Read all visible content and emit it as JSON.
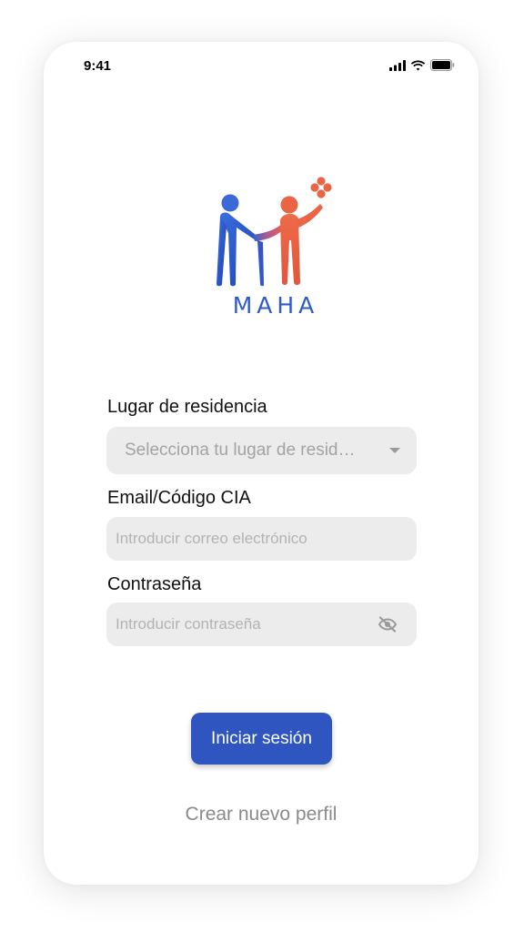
{
  "status_bar": {
    "time": "9:41",
    "icons": [
      "signal-icon",
      "wifi-icon",
      "battery-icon"
    ]
  },
  "logo": {
    "text": "MAHA",
    "colors": {
      "blue": "#2f5bc6",
      "orange": "#ea6446"
    }
  },
  "form": {
    "residence": {
      "label": "Lugar de residencia",
      "value": "Selecciona tu lugar de resid…"
    },
    "email": {
      "label": "Email/Código CIA",
      "placeholder": "Introducir correo electrónico"
    },
    "password": {
      "label": "Contraseña",
      "placeholder": "Introducir contraseña",
      "toggle_icon": "eye-off-icon"
    }
  },
  "actions": {
    "login_label": "Iniciar sesión",
    "create_profile_label": "Crear nuevo perfil"
  },
  "colors": {
    "primary": "#2f55c0",
    "field_bg": "#ececec",
    "placeholder": "#b3b3b3",
    "link": "#8a8a8e"
  }
}
